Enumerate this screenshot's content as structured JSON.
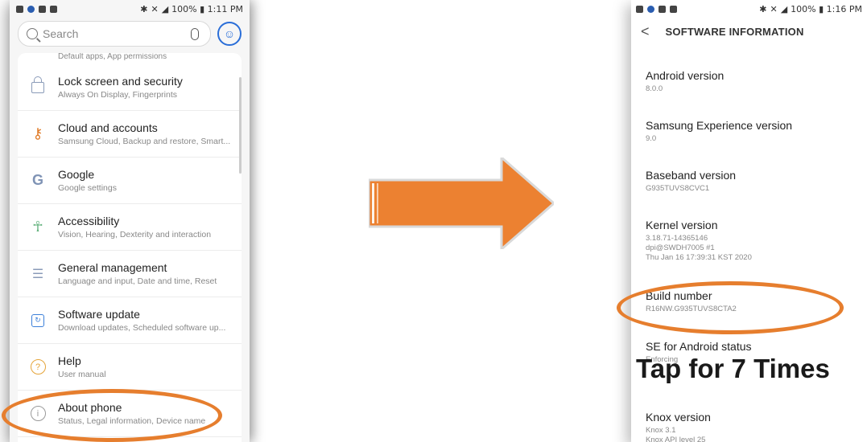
{
  "left_phone": {
    "status": {
      "right": "100% ▮ 1:11 PM"
    },
    "search": {
      "placeholder": "Search"
    },
    "partial_text": "Default apps, App permissions",
    "items": [
      {
        "title": "Lock screen and security",
        "sub": "Always On Display, Fingerprints",
        "icon": "lock-icon"
      },
      {
        "title": "Cloud and accounts",
        "sub": "Samsung Cloud, Backup and restore, Smart...",
        "icon": "key-icon"
      },
      {
        "title": "Google",
        "sub": "Google settings",
        "icon": "google-icon"
      },
      {
        "title": "Accessibility",
        "sub": "Vision, Hearing, Dexterity and interaction",
        "icon": "accessibility-icon"
      },
      {
        "title": "General management",
        "sub": "Language and input, Date and time, Reset",
        "icon": "sliders-icon"
      },
      {
        "title": "Software update",
        "sub": "Download updates, Scheduled software up...",
        "icon": "update-icon"
      },
      {
        "title": "Help",
        "sub": "User manual",
        "icon": "help-icon"
      },
      {
        "title": "About phone",
        "sub": "Status, Legal information, Device name",
        "icon": "info-icon"
      }
    ]
  },
  "right_phone": {
    "status": {
      "right": "100% ▮ 1:16 PM"
    },
    "header_title": "SOFTWARE INFORMATION",
    "entries": [
      {
        "title": "Android version",
        "value": "8.0.0"
      },
      {
        "title": "Samsung Experience version",
        "value": "9.0"
      },
      {
        "title": "Baseband version",
        "value": "G935TUVS8CVC1"
      },
      {
        "title": "Kernel version",
        "value": "3.18.71-14365146",
        "value2": "dpi@SWDH7005 #1",
        "value3": "Thu Jan 16 17:39:31 KST 2020"
      },
      {
        "title": "Build number",
        "value": "R16NW.G935TUVS8CTA2"
      },
      {
        "title": "SE for Android status",
        "value": "Enforcing"
      },
      {
        "title": "Knox version",
        "value": "Knox 3.1",
        "value2": "Knox API level 25"
      }
    ]
  },
  "annotation": {
    "tap_text": "Tap for 7 Times"
  },
  "colors": {
    "accent_orange": "#e67e2e",
    "arrow_orange": "#ec8131"
  }
}
